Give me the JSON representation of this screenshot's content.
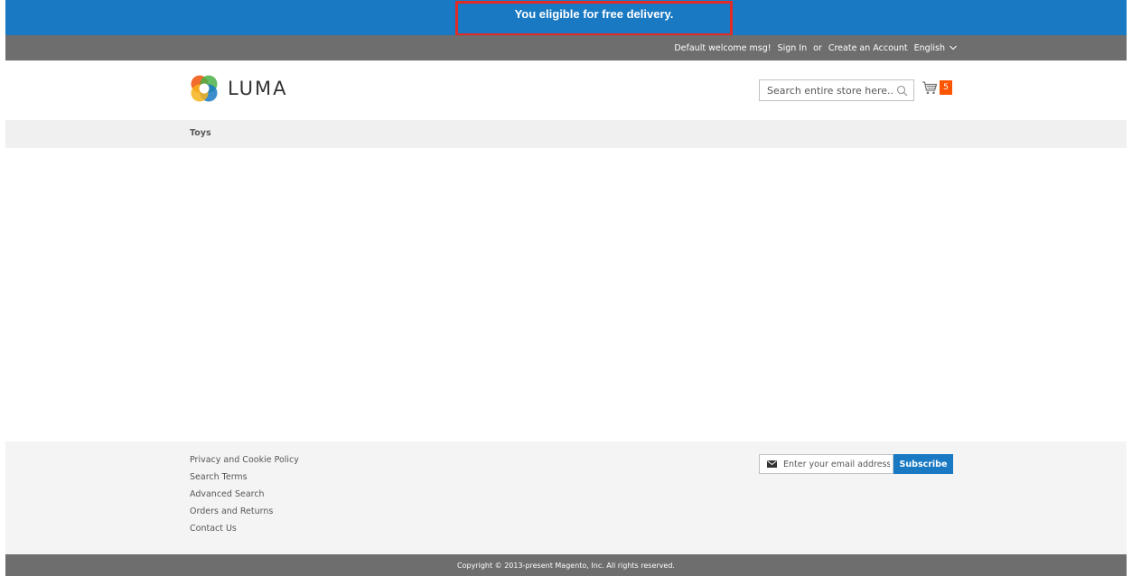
{
  "promo": {
    "message": "You eligible for free delivery.",
    "background": "#1979c3",
    "highlight_border": "#e02b27"
  },
  "header": {
    "welcome": "Default welcome msg!",
    "sign_in": "Sign In",
    "or": "or",
    "create_account": "Create an Account",
    "language": "English",
    "language_icon": "chevron-down-icon",
    "background": "#6e6e6e"
  },
  "logo": {
    "text": "LUMA",
    "icon": "luma-logo-icon"
  },
  "search": {
    "placeholder": "Search entire store here...",
    "value": "",
    "icon": "search-icon"
  },
  "cart": {
    "icon": "cart-icon",
    "count": "5",
    "badge_color": "#ff5501"
  },
  "nav": {
    "items": [
      {
        "label": "Toys"
      }
    ]
  },
  "footer": {
    "links": [
      {
        "label": "Privacy and Cookie Policy"
      },
      {
        "label": "Search Terms"
      },
      {
        "label": "Advanced Search"
      },
      {
        "label": "Orders and Returns"
      },
      {
        "label": "Contact Us"
      }
    ],
    "newsletter": {
      "placeholder": "Enter your email address",
      "value": "",
      "icon": "envelope-icon",
      "subscribe_label": "Subscribe"
    },
    "copyright": "Copyright © 2013-present Magento, Inc. All rights reserved."
  }
}
